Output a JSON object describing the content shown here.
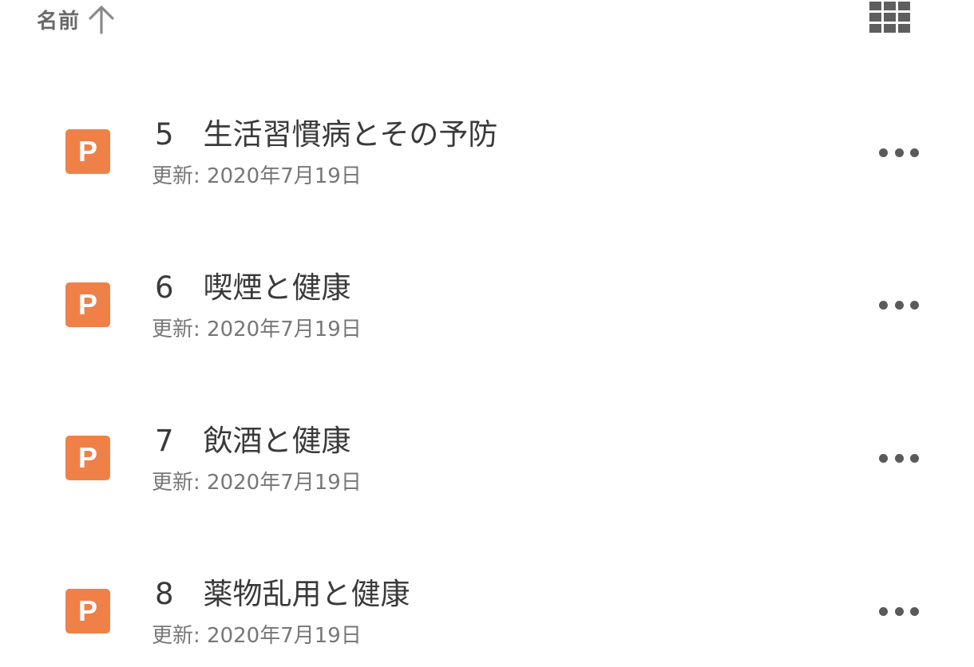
{
  "header": {
    "sort_label": "名前",
    "sort_direction": "ascending",
    "sort_icon": "arrow-up-icon",
    "view_toggle_icon": "grid-view-icon"
  },
  "colors": {
    "file_icon_bg": "#ef8148",
    "text_primary": "#3a3a3a",
    "text_secondary": "#777777"
  },
  "files": [
    {
      "icon_letter": "P",
      "icon_name": "powerpoint-file-icon",
      "title": "5　生活習慣病とその予防",
      "updated": "更新: 2020年7月19日",
      "more_icon": "more-horizontal-icon"
    },
    {
      "icon_letter": "P",
      "icon_name": "powerpoint-file-icon",
      "title": "6　喫煙と健康",
      "updated": "更新: 2020年7月19日",
      "more_icon": "more-horizontal-icon"
    },
    {
      "icon_letter": "P",
      "icon_name": "powerpoint-file-icon",
      "title": "7　飲酒と健康",
      "updated": "更新: 2020年7月19日",
      "more_icon": "more-horizontal-icon"
    },
    {
      "icon_letter": "P",
      "icon_name": "powerpoint-file-icon",
      "title": "8　薬物乱用と健康",
      "updated": "更新: 2020年7月19日",
      "more_icon": "more-horizontal-icon"
    }
  ]
}
